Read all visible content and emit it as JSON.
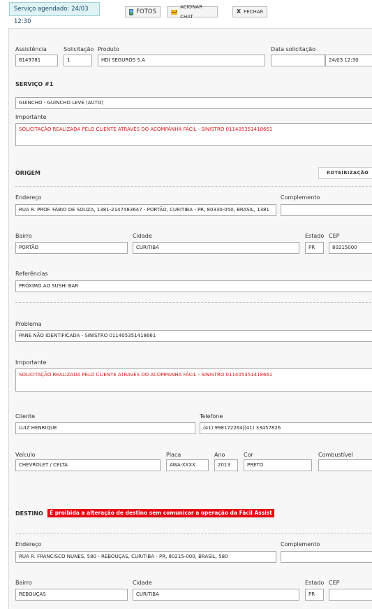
{
  "toolbar": {
    "scheduled": "Serviço agendado: 24/03 12:30",
    "fotos": "FOTOS",
    "chat": "ACIONAR CHAT",
    "fechar_icon": "X",
    "fechar": "FECHAR"
  },
  "header": {
    "assistencia_label": "Assistência",
    "assistencia": "8149781",
    "solicitacao_label": "Solicitação",
    "solicitacao": "1",
    "produto_label": "Produto",
    "produto": "HDI SEGUROS S.A",
    "data_label": "Data solicitação",
    "data_value": "24/03 12:30"
  },
  "servico": {
    "title": "SERVIÇO #1",
    "tipo": "GUINCHO - GUINCHO LEVE (AUTO)",
    "importante_label": "Importante",
    "importante": "SOLICITAÇÃO REALIZADA PELO CLIENTE ATRAVÉS DO ACOMPANHA FÁCIL - SINISTRO 011405351418661"
  },
  "origem": {
    "title": "ORIGEM",
    "roteirizacao": "ROTEIRIZAÇÃO",
    "endereco_label": "Endereço",
    "endereco": "RUA R. PROF. FÁBIO DE SOUZA, 1381-2147483647 - PORTÃO, CURITIBA - PR, 80330-050, BRASIL, 1381",
    "complemento_label": "Complemento",
    "complemento": "",
    "bairro_label": "Bairro",
    "bairro": "PORTÃO",
    "cidade_label": "Cidade",
    "cidade": "CURITIBA",
    "estado_label": "Estado",
    "estado": "PR",
    "cep_label": "CEP",
    "cep": "80215000",
    "referencias_label": "Referências",
    "referencias": "PRÓXIMO AO SUSHI BAR"
  },
  "detalhes": {
    "problema_label": "Problema",
    "problema": "PANE NÃO IDENTIFICADA - SINISTRO 011405351418661",
    "importante_label": "Importante",
    "importante": "SOLICITAÇÃO REALIZADA PELO CLIENTE ATRAVÉS DO ACOMPANHA FÁCIL - SINISTRO 011405351418661",
    "cliente_label": "Cliente",
    "cliente": "LUIZ HENRIQUE",
    "telefone_label": "Telefone",
    "telefone": "(41) 998172264|(41) 33457826",
    "veiculo_label": "Veículo",
    "veiculo": "CHEVROLET / CELTA",
    "placa_label": "Placa",
    "placa": "AWA-XXXX",
    "ano_label": "Ano",
    "ano": "2013",
    "cor_label": "Cor",
    "cor": "PRETO",
    "combustivel_label": "Combustível",
    "combustivel": ""
  },
  "destino": {
    "title": "DESTINO",
    "warning": "É proibida a alteração de destino sem comunicar a operação da Fácil Assist",
    "endereco_label": "Endereço",
    "endereco": "RUA R. FRANCISCO NUNES, 580 - REBOUÇAS, CURITIBA - PR, 80215-000, BRASIL, 580",
    "complemento_label": "Complemento",
    "complemento": "",
    "bairro_label": "Bairro",
    "bairro": "REBOUÇAS",
    "cidade_label": "Cidade",
    "cidade": "CURITIBA",
    "estado_label": "Estado",
    "estado": "PR",
    "cep_label": "CEP",
    "cep": ""
  },
  "colors": {
    "warning_bg": "#e60012",
    "important_text": "#d51a1a",
    "schedule_bg": "#dff3f4"
  },
  "icons": {
    "fotos": "image-icon",
    "chat": "envelope-icon",
    "fechar": "close-icon"
  }
}
